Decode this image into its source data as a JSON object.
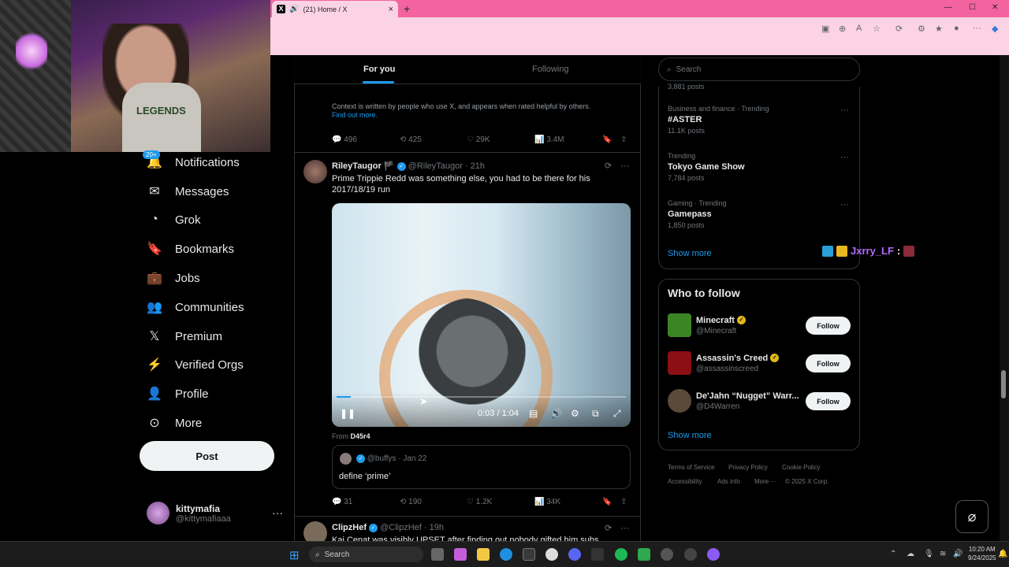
{
  "browser": {
    "tab_title": "(21) Home / X",
    "tab_close": "×",
    "new_tab": "+",
    "win_min": "—",
    "win_max": "☐",
    "win_close": "✕"
  },
  "webcam": {
    "shirt_text": "LEGENDS"
  },
  "nav": {
    "badge": "20+",
    "items": [
      {
        "label": "Notifications",
        "icon": "bell-icon",
        "glyph": "🔔"
      },
      {
        "label": "Messages",
        "icon": "envelope-icon",
        "glyph": "✉"
      },
      {
        "label": "Grok",
        "icon": "grok-icon",
        "glyph": "◔"
      },
      {
        "label": "Bookmarks",
        "icon": "bookmark-icon",
        "glyph": "🔖"
      },
      {
        "label": "Jobs",
        "icon": "briefcase-icon",
        "glyph": "💼"
      },
      {
        "label": "Communities",
        "icon": "people-icon",
        "glyph": "👥"
      },
      {
        "label": "Premium",
        "icon": "x-logo-icon",
        "glyph": "𝕏"
      },
      {
        "label": "Verified Orgs",
        "icon": "lightning-icon",
        "glyph": "⚡"
      },
      {
        "label": "Profile",
        "icon": "person-icon",
        "glyph": "👤"
      },
      {
        "label": "More",
        "icon": "more-circle-icon",
        "glyph": "⊙"
      }
    ],
    "post_label": "Post",
    "account": {
      "name": "kittymafia",
      "handle": "@kittymafiaaa",
      "more": "···"
    }
  },
  "feed": {
    "tabs": {
      "for_you": "For you",
      "following": "Following"
    },
    "note_context": "Context is written by people who use X, and appears when rated helpful by others.",
    "note_link": "Find out more.",
    "post0_actions": {
      "replies": "496",
      "reposts": "425",
      "likes": "29K",
      "views": "3.4M"
    },
    "post1": {
      "name": "RileyTaugor",
      "flag": "🏴",
      "handle": "@RileyTaugor",
      "time": "· 21h",
      "text": "Prime Trippie Redd was something else, you had to be there for his 2017/18/19 run",
      "video_time": "0:03 / 1:04",
      "from_label": "From",
      "from_user": "D45r4",
      "quote": {
        "handle": "@buffys",
        "time": "· Jan 22",
        "text": "define ‘prime’"
      },
      "actions": {
        "replies": "31",
        "reposts": "190",
        "likes": "1.2K",
        "views": "34K"
      }
    },
    "post2": {
      "name": "ClipzHef",
      "handle": "@ClipzHef",
      "time": "· 19h",
      "text": "Kai Cenat was visibly UPSET after finding out nobody gifted him subs"
    }
  },
  "sidebar": {
    "search_placeholder": "Search",
    "trends": [
      {
        "context": "",
        "name": "",
        "count": "3,881 posts"
      },
      {
        "context": "Business and finance · Trending",
        "name": "#ASTER",
        "count": "11.1K posts"
      },
      {
        "context": "Trending",
        "name": "Tokyo Game Show",
        "count": "7,784 posts"
      },
      {
        "context": "Gaming · Trending",
        "name": "Gamepass",
        "count": "1,850 posts"
      }
    ],
    "show_more": "Show more",
    "who_to_follow": "Who to follow",
    "suggestions": [
      {
        "name": "Minecraft",
        "handle": "@Minecraft",
        "color": "#3c8527"
      },
      {
        "name": "Assassin's Creed",
        "handle": "@assassinscreed",
        "color": "#8b0f14"
      },
      {
        "name": "De'Jahn “Nugget” Warr...",
        "handle": "@D4Warren",
        "color": "#5a4a3a"
      }
    ],
    "follow_label": "Follow",
    "show_more_2": "Show more",
    "footer": [
      "Terms of Service",
      "Privacy Policy",
      "Cookie Policy",
      "Accessibility",
      "Ads info",
      "More ···",
      "© 2025 X Corp."
    ]
  },
  "chat_overlay": {
    "user": "Jxrry_LF",
    "sep": ":"
  },
  "taskbar": {
    "search": "Search",
    "time": "10:20 AM",
    "date": "9/24/2025"
  },
  "colors": {
    "accent": "#1d9bf0",
    "tab_bar": "#f2639f",
    "chat": "#b36bff"
  }
}
